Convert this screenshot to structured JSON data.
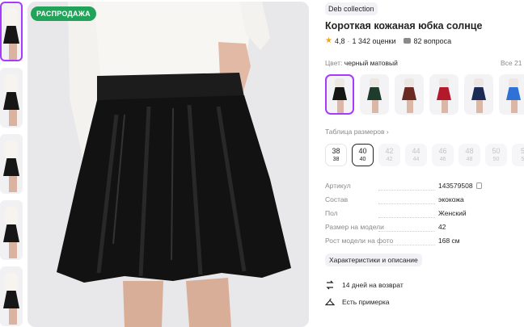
{
  "gallery": {
    "badge": "РАСПРОДАЖА"
  },
  "product": {
    "brand": "Deb collection",
    "title": "Короткая кожаная юбка солнце",
    "rating": "4,8",
    "reviews": "1 342 оценки",
    "questions": "82 вопроса"
  },
  "color": {
    "label": "Цвет:",
    "value": "черный матовый",
    "all": "Все 21",
    "swatches": [
      {
        "color": "#151515"
      },
      {
        "color": "#1f3b2c"
      },
      {
        "color": "#6a2a23"
      },
      {
        "color": "#b3182b"
      },
      {
        "color": "#1c2b55"
      },
      {
        "color": "#2f72d6"
      }
    ]
  },
  "sizes": {
    "table_link": "Таблица размеров",
    "chevron": "›",
    "items": [
      {
        "ru": "38",
        "eu": "38"
      },
      {
        "ru": "40",
        "eu": "40"
      },
      {
        "ru": "42",
        "eu": "42"
      },
      {
        "ru": "44",
        "eu": "44"
      },
      {
        "ru": "46",
        "eu": "46"
      },
      {
        "ru": "48",
        "eu": "48"
      },
      {
        "ru": "50",
        "eu": "50"
      },
      {
        "ru": "5",
        "eu": "5"
      }
    ]
  },
  "specs": [
    {
      "key": "Артикул",
      "value": "143579508"
    },
    {
      "key": "Состав",
      "value": "экокожа"
    },
    {
      "key": "Пол",
      "value": "Женский"
    },
    {
      "key": "Размер на модели",
      "value": "42"
    },
    {
      "key": "Рост модели на фото",
      "value": "168 см"
    }
  ],
  "details_button": "Характеристики и описание",
  "features": [
    {
      "icon": "return-arrows-icon",
      "text": "14 дней на возврат"
    },
    {
      "icon": "hanger-icon",
      "text": "Есть примерка"
    }
  ],
  "colors": {
    "accent": "#a73afd",
    "sale": "#22a35a",
    "star": "#f6a600"
  }
}
